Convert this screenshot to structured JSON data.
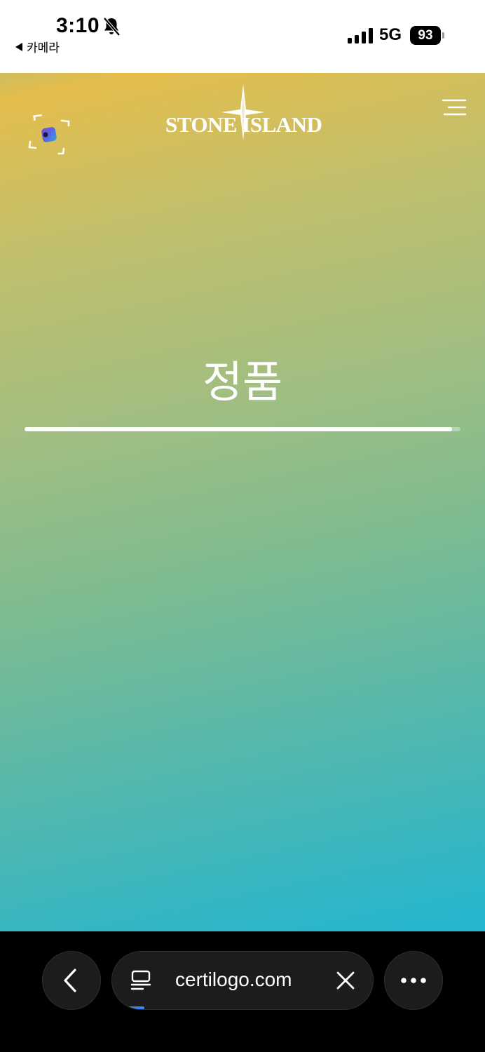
{
  "status_bar": {
    "time": "3:10",
    "back_app_label": "카메라",
    "network": "5G",
    "battery_percent": "93",
    "icons": [
      "bell-slash-icon",
      "cellular-signal-icon",
      "battery-icon"
    ]
  },
  "header": {
    "brand": "STONE ISLAND",
    "icons": [
      "scan-icon",
      "compass-star-logo",
      "menu-icon"
    ]
  },
  "main": {
    "result_title": "정품",
    "progress_fraction": 0.98
  },
  "browser": {
    "url": "certilogo.com",
    "icons": [
      "chevron-left-icon",
      "page-icon",
      "close-icon",
      "more-icon"
    ]
  },
  "colors": {
    "gradient_top": "#e4bd4c",
    "gradient_mid": "#9fbe82",
    "gradient_bottom": "#22b6d0",
    "toolbar_bg": "#000000",
    "pill_bg": "#1c1c1e",
    "load_progress": "#3b82f6"
  }
}
